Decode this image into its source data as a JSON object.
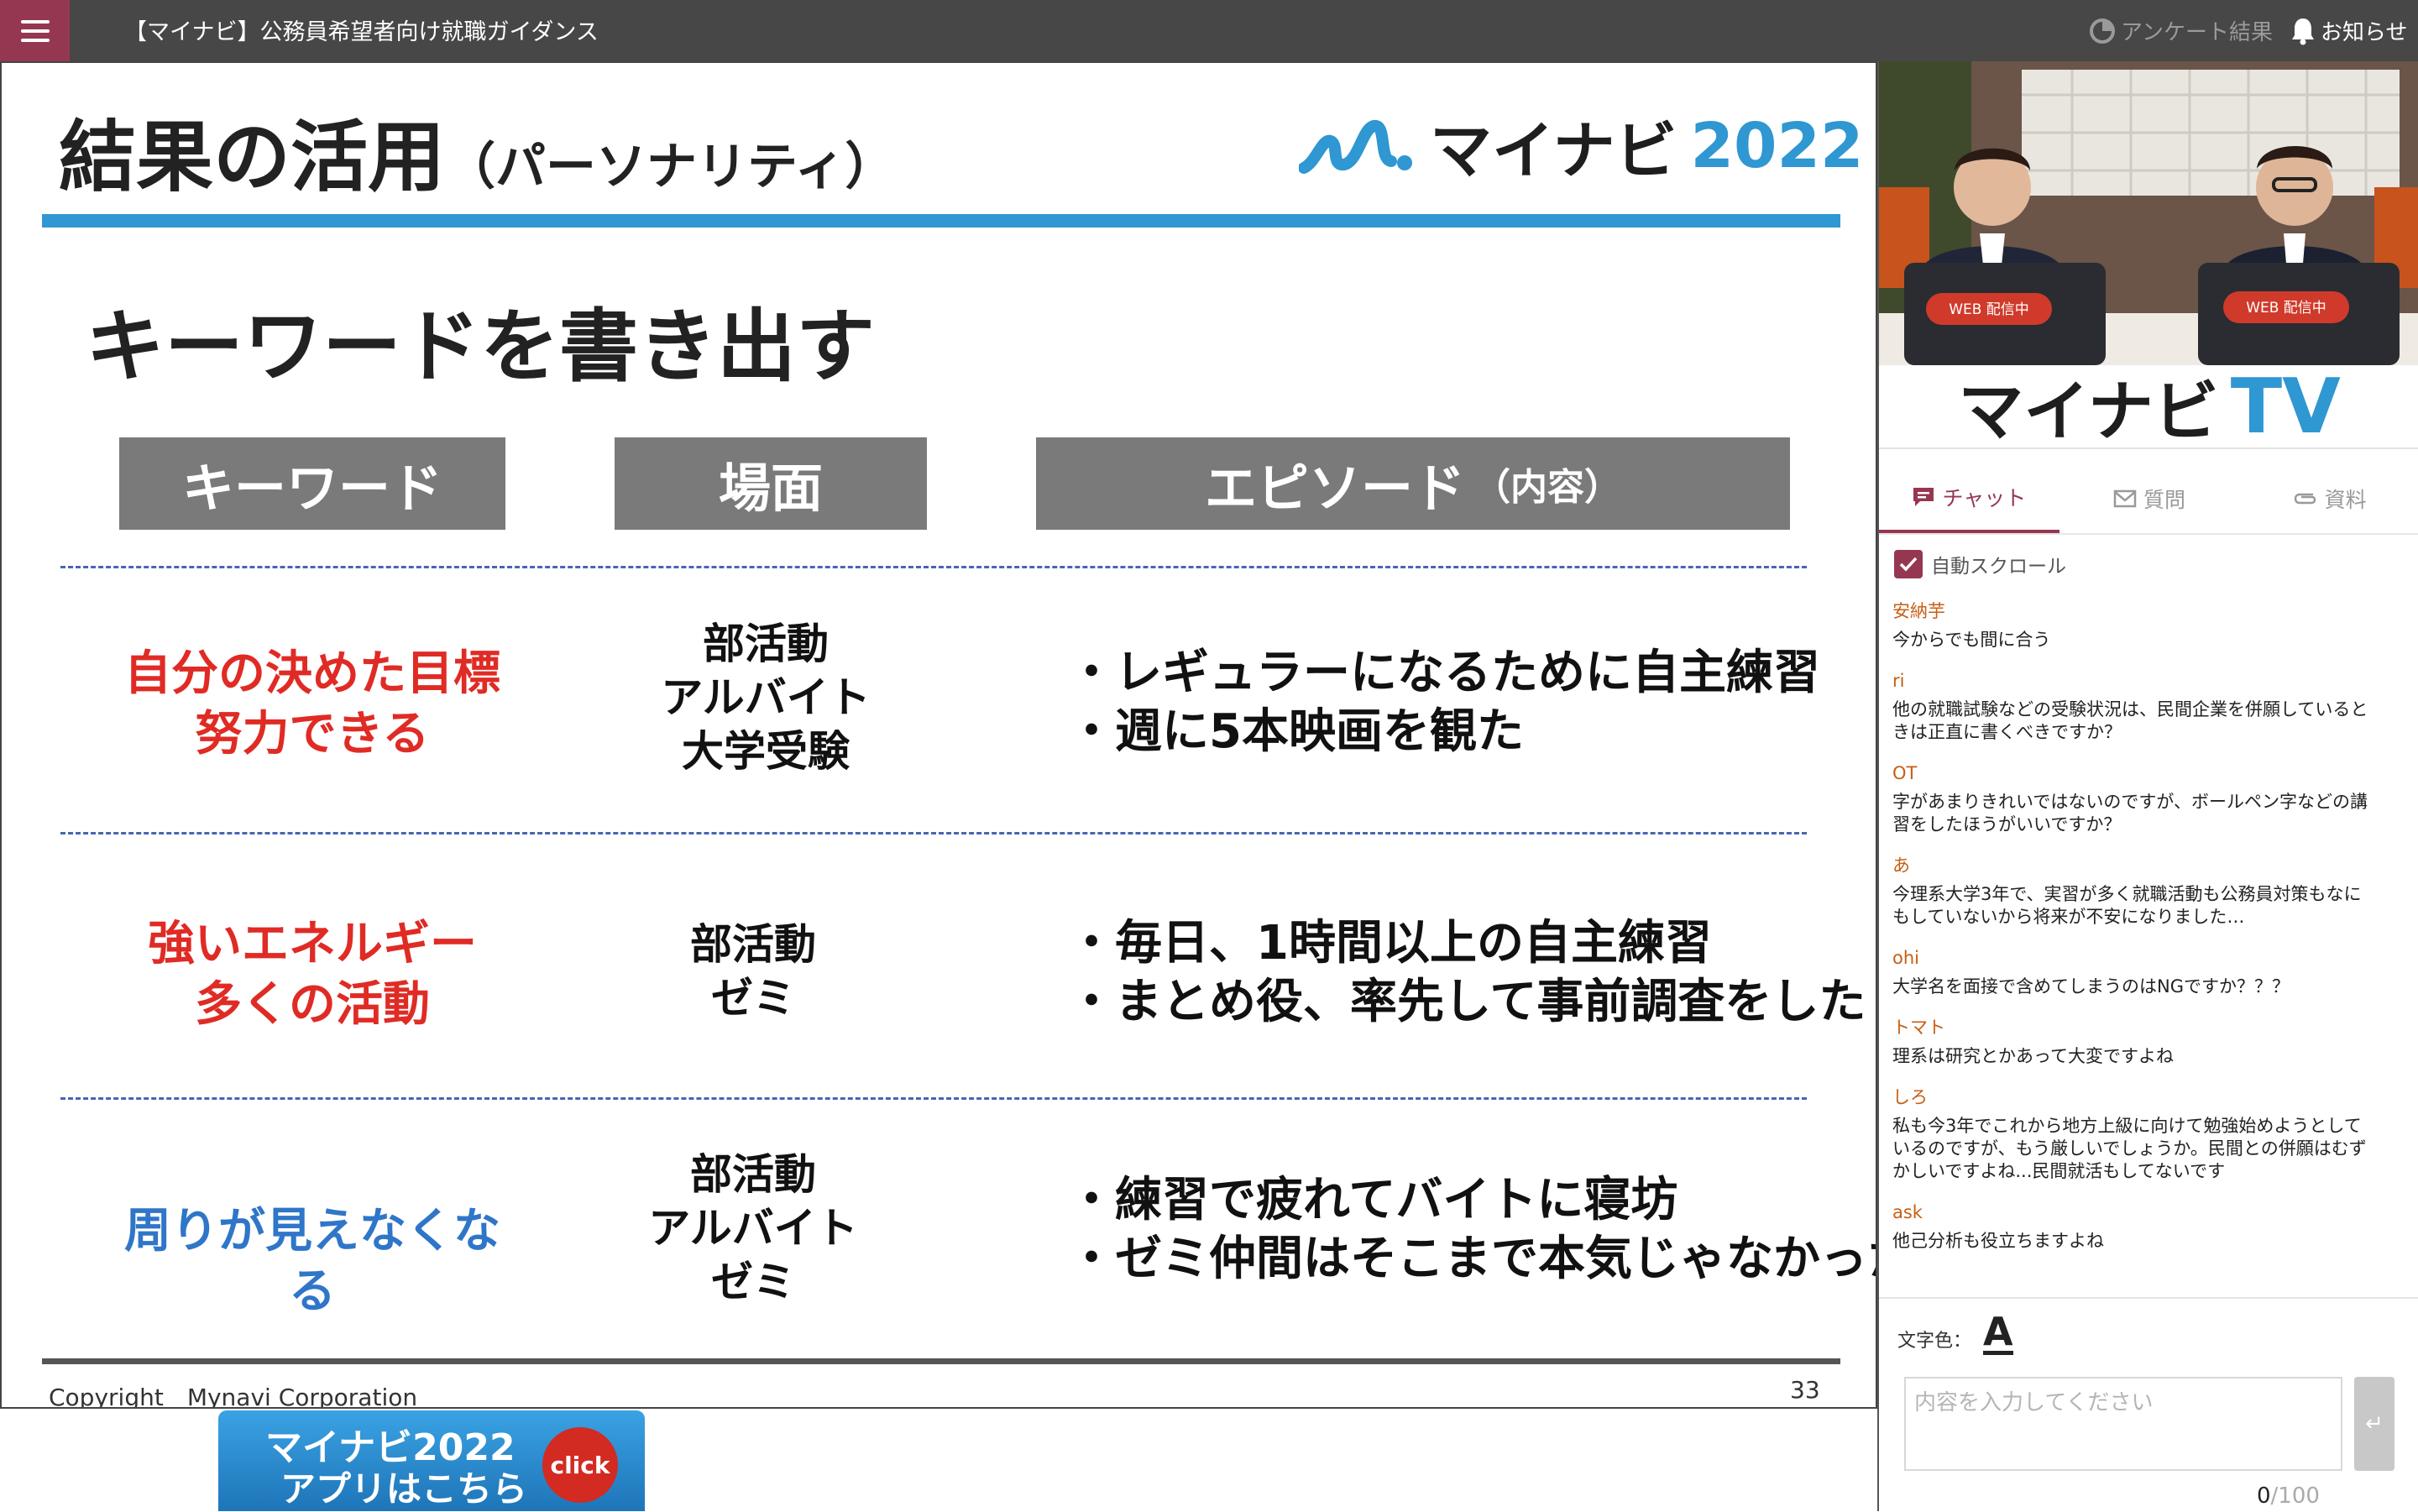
{
  "topbar": {
    "menu_icon": "hamburger-icon",
    "title": "【マイナビ】公務員希望者向け就職ガイダンス",
    "survey_label": "アンケート結果",
    "notice_label": "お知らせ"
  },
  "slide": {
    "title": "結果の活用",
    "title_paren": "（パーソナリティ）",
    "logo_brand": "マイナビ",
    "logo_year": "2022",
    "subtitle": "キーワードを書き出す",
    "headers": {
      "keyword": "キーワード",
      "scene": "場面",
      "episode": "エピソード",
      "episode_paren": "（内容）"
    },
    "rows": [
      {
        "kw1": "自分の決めた目標",
        "kw2": "努力できる",
        "scenes": [
          "部活動",
          "アルバイト",
          "大学受験"
        ],
        "ep1": "・レギュラーになるために自主練習",
        "ep2": "・週に5本映画を観た"
      },
      {
        "kw1": "強いエネルギー",
        "kw2": "多くの活動",
        "scenes": [
          "部活動",
          "ゼミ"
        ],
        "ep1": "・毎日、1時間以上の自主練習",
        "ep2": "・まとめ役、率先して事前調査をした"
      },
      {
        "kw1": "周りが見えなくなる",
        "scenes": [
          "部活動",
          "アルバイト",
          "ゼミ"
        ],
        "ep1": "・練習で疲れてバイトに寝坊",
        "ep2": "・ゼミ仲間はそこまで本気じゃなかった"
      }
    ],
    "colors": {
      "accent": "#2f97d2",
      "red": "#e02b25",
      "blue": "#2f76c8",
      "header_bg": "#7a7a7a"
    },
    "copyright": "Copyright　Mynavi Corporation",
    "page_number": "33"
  },
  "app_banner": {
    "line1": "マイナビ2022",
    "line2": "アプリはこちら",
    "badge": "click"
  },
  "panel": {
    "video_badge": "WEB 配信中",
    "tv_brand": "マイナビ",
    "tv_letters": "TV",
    "tabs": [
      {
        "label": "チャット",
        "icon": "chat-icon"
      },
      {
        "label": "質問",
        "icon": "mail-icon"
      },
      {
        "label": "資料",
        "icon": "paperclip-icon"
      }
    ],
    "autoscroll_label": "自動スクロール",
    "messages": [
      {
        "name": "安納芋",
        "text": "今からでも間に合う"
      },
      {
        "name": "ri",
        "text": "他の就職試験などの受験状況は、民間企業を併願していると\nきは正直に書くべきですか？"
      },
      {
        "name": "OT",
        "text": "字があまりきれいではないのですが、ボールペン字などの講\n習をしたほうがいいですか？"
      },
      {
        "name": "あ",
        "text": "今理系大学3年で、実習が多く就職活動も公務員対策もなに\nもしていないから将来が不安になりました…"
      },
      {
        "name": "ohi",
        "text": "大学名を面接で含めてしまうのはNGですか？？？"
      },
      {
        "name": "トマト",
        "text": "理系は研究とかあって大変ですよね"
      },
      {
        "name": "しろ",
        "text": "私も今3年でこれから地方上級に向けて勉強始めようとして\nいるのですが、もう厳しいでしょうか。民間との併願はむず\nかしいですよね...民間就活もしてないです"
      },
      {
        "name": "ask",
        "text": "他己分析も役立ちますよね"
      }
    ],
    "font_color_label": "文字色：",
    "font_color_icon": "A",
    "input_placeholder": "内容を入力してください",
    "send_icon": "↵",
    "counter_current": "0",
    "counter_max": "/100"
  }
}
